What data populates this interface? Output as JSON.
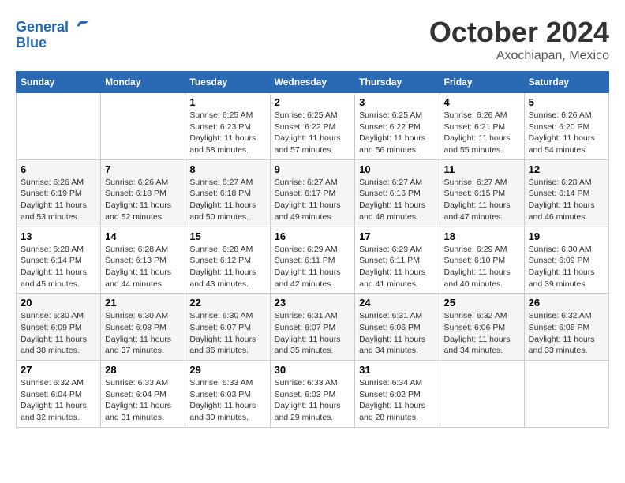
{
  "header": {
    "logo_line1": "General",
    "logo_line2": "Blue",
    "month": "October 2024",
    "location": "Axochiapan, Mexico"
  },
  "weekdays": [
    "Sunday",
    "Monday",
    "Tuesday",
    "Wednesday",
    "Thursday",
    "Friday",
    "Saturday"
  ],
  "weeks": [
    [
      {
        "day": "",
        "info": ""
      },
      {
        "day": "",
        "info": ""
      },
      {
        "day": "1",
        "info": "Sunrise: 6:25 AM\nSunset: 6:23 PM\nDaylight: 11 hours and 58 minutes."
      },
      {
        "day": "2",
        "info": "Sunrise: 6:25 AM\nSunset: 6:22 PM\nDaylight: 11 hours and 57 minutes."
      },
      {
        "day": "3",
        "info": "Sunrise: 6:25 AM\nSunset: 6:22 PM\nDaylight: 11 hours and 56 minutes."
      },
      {
        "day": "4",
        "info": "Sunrise: 6:26 AM\nSunset: 6:21 PM\nDaylight: 11 hours and 55 minutes."
      },
      {
        "day": "5",
        "info": "Sunrise: 6:26 AM\nSunset: 6:20 PM\nDaylight: 11 hours and 54 minutes."
      }
    ],
    [
      {
        "day": "6",
        "info": "Sunrise: 6:26 AM\nSunset: 6:19 PM\nDaylight: 11 hours and 53 minutes."
      },
      {
        "day": "7",
        "info": "Sunrise: 6:26 AM\nSunset: 6:18 PM\nDaylight: 11 hours and 52 minutes."
      },
      {
        "day": "8",
        "info": "Sunrise: 6:27 AM\nSunset: 6:18 PM\nDaylight: 11 hours and 50 minutes."
      },
      {
        "day": "9",
        "info": "Sunrise: 6:27 AM\nSunset: 6:17 PM\nDaylight: 11 hours and 49 minutes."
      },
      {
        "day": "10",
        "info": "Sunrise: 6:27 AM\nSunset: 6:16 PM\nDaylight: 11 hours and 48 minutes."
      },
      {
        "day": "11",
        "info": "Sunrise: 6:27 AM\nSunset: 6:15 PM\nDaylight: 11 hours and 47 minutes."
      },
      {
        "day": "12",
        "info": "Sunrise: 6:28 AM\nSunset: 6:14 PM\nDaylight: 11 hours and 46 minutes."
      }
    ],
    [
      {
        "day": "13",
        "info": "Sunrise: 6:28 AM\nSunset: 6:14 PM\nDaylight: 11 hours and 45 minutes."
      },
      {
        "day": "14",
        "info": "Sunrise: 6:28 AM\nSunset: 6:13 PM\nDaylight: 11 hours and 44 minutes."
      },
      {
        "day": "15",
        "info": "Sunrise: 6:28 AM\nSunset: 6:12 PM\nDaylight: 11 hours and 43 minutes."
      },
      {
        "day": "16",
        "info": "Sunrise: 6:29 AM\nSunset: 6:11 PM\nDaylight: 11 hours and 42 minutes."
      },
      {
        "day": "17",
        "info": "Sunrise: 6:29 AM\nSunset: 6:11 PM\nDaylight: 11 hours and 41 minutes."
      },
      {
        "day": "18",
        "info": "Sunrise: 6:29 AM\nSunset: 6:10 PM\nDaylight: 11 hours and 40 minutes."
      },
      {
        "day": "19",
        "info": "Sunrise: 6:30 AM\nSunset: 6:09 PM\nDaylight: 11 hours and 39 minutes."
      }
    ],
    [
      {
        "day": "20",
        "info": "Sunrise: 6:30 AM\nSunset: 6:09 PM\nDaylight: 11 hours and 38 minutes."
      },
      {
        "day": "21",
        "info": "Sunrise: 6:30 AM\nSunset: 6:08 PM\nDaylight: 11 hours and 37 minutes."
      },
      {
        "day": "22",
        "info": "Sunrise: 6:30 AM\nSunset: 6:07 PM\nDaylight: 11 hours and 36 minutes."
      },
      {
        "day": "23",
        "info": "Sunrise: 6:31 AM\nSunset: 6:07 PM\nDaylight: 11 hours and 35 minutes."
      },
      {
        "day": "24",
        "info": "Sunrise: 6:31 AM\nSunset: 6:06 PM\nDaylight: 11 hours and 34 minutes."
      },
      {
        "day": "25",
        "info": "Sunrise: 6:32 AM\nSunset: 6:06 PM\nDaylight: 11 hours and 34 minutes."
      },
      {
        "day": "26",
        "info": "Sunrise: 6:32 AM\nSunset: 6:05 PM\nDaylight: 11 hours and 33 minutes."
      }
    ],
    [
      {
        "day": "27",
        "info": "Sunrise: 6:32 AM\nSunset: 6:04 PM\nDaylight: 11 hours and 32 minutes."
      },
      {
        "day": "28",
        "info": "Sunrise: 6:33 AM\nSunset: 6:04 PM\nDaylight: 11 hours and 31 minutes."
      },
      {
        "day": "29",
        "info": "Sunrise: 6:33 AM\nSunset: 6:03 PM\nDaylight: 11 hours and 30 minutes."
      },
      {
        "day": "30",
        "info": "Sunrise: 6:33 AM\nSunset: 6:03 PM\nDaylight: 11 hours and 29 minutes."
      },
      {
        "day": "31",
        "info": "Sunrise: 6:34 AM\nSunset: 6:02 PM\nDaylight: 11 hours and 28 minutes."
      },
      {
        "day": "",
        "info": ""
      },
      {
        "day": "",
        "info": ""
      }
    ]
  ]
}
